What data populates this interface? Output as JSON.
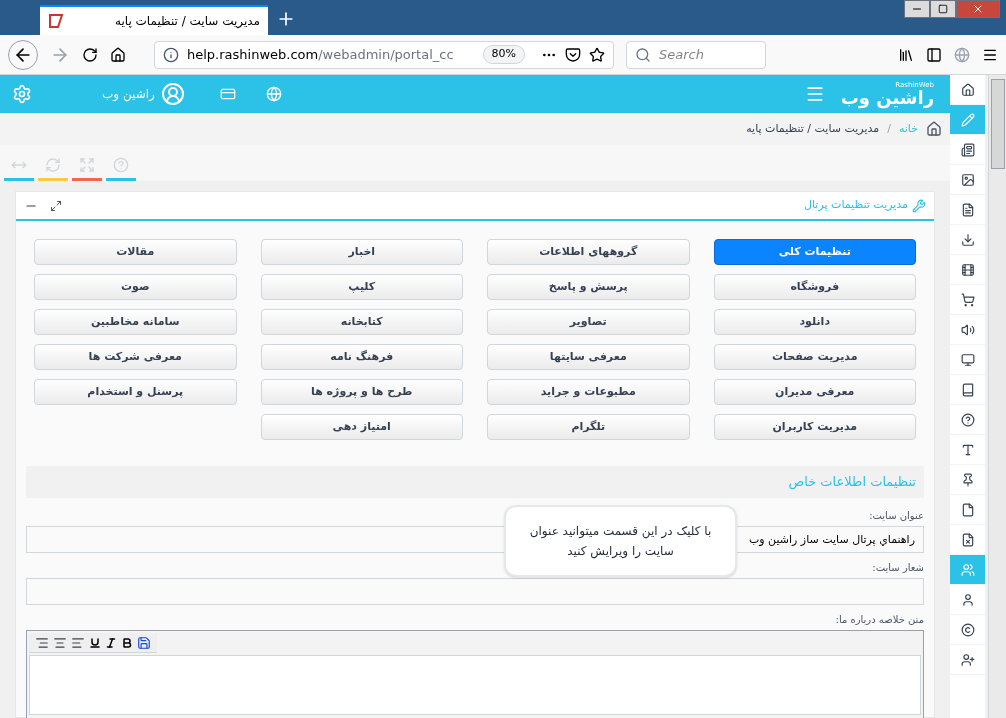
{
  "browser": {
    "tab_title": "مدیریت سایت / تنظیمات پایه",
    "url_host": "help.rashinweb.com",
    "url_path": "/webadmin/portal_cc",
    "zoom": "80%",
    "search": {
      "placeholder": "Search"
    }
  },
  "header": {
    "logo_text": "راشین وب",
    "logo_subtext": "RashinWeb",
    "user_name": "راشین وب"
  },
  "breadcrumb": [
    {
      "label": "خانه",
      "kind": "link"
    },
    {
      "label": "/",
      "kind": "separator"
    },
    {
      "label": "مدیریت سایت / تنظیمات پایه",
      "kind": "current"
    }
  ],
  "tools": [
    {
      "kind": "arrows",
      "color": "#2cc1e6"
    },
    {
      "kind": "refresh",
      "color": "#f9c846"
    },
    {
      "kind": "expand",
      "color": "#f3664c"
    },
    {
      "kind": "help",
      "color": "#2cc1e6"
    }
  ],
  "panel": {
    "title": "مدیریت تنظیمات پرتال",
    "modules": [
      {
        "label": "تنظیمات کلی",
        "selected": true
      },
      {
        "label": "گروههای اطلاعات",
        "selected": false
      },
      {
        "label": "اخبار",
        "selected": false
      },
      {
        "label": "مقالات",
        "selected": false
      },
      {
        "label": "فروشگاه",
        "selected": false
      },
      {
        "label": "پرسش و پاسخ",
        "selected": false
      },
      {
        "label": "کلیپ",
        "selected": false
      },
      {
        "label": "صوت",
        "selected": false
      },
      {
        "label": "دانلود",
        "selected": false
      },
      {
        "label": "تصاویر",
        "selected": false
      },
      {
        "label": "کتابخانه",
        "selected": false
      },
      {
        "label": "سامانه مخاطبین",
        "selected": false
      },
      {
        "label": "مدیریت صفحات",
        "selected": false
      },
      {
        "label": "معرفی سایتها",
        "selected": false
      },
      {
        "label": "فرهنگ نامه",
        "selected": false
      },
      {
        "label": "معرفی شرکت ها",
        "selected": false
      },
      {
        "label": "معرفی مدیران",
        "selected": false
      },
      {
        "label": "مطبوعات و جراید",
        "selected": false
      },
      {
        "label": "طرح ها و پروژه ها",
        "selected": false
      },
      {
        "label": "پرسنل و استخدام",
        "selected": false
      },
      {
        "label": "مدیریت کاربران",
        "selected": false
      },
      {
        "label": "تلگرام",
        "selected": false
      },
      {
        "label": "امتیاز دهی",
        "selected": false
      }
    ],
    "section_title": "تنظیمات اطلاعات خاص",
    "fields": [
      {
        "label": "عنوان سایت:",
        "value": "راهنماي پرتال سایت ساز راشین وب"
      },
      {
        "label": "شعار سایت:"
      }
    ],
    "tooltip": "با کلیک در این قسمت میتوانید عنوان سایت را ویرایش کنید",
    "editor": {
      "label": "متن خلاصه درباره ما:",
      "toolbar": [
        {
          "kind": "align-right"
        },
        {
          "kind": "align-center"
        },
        {
          "kind": "align-left"
        },
        {
          "kind": "underline"
        },
        {
          "kind": "italic"
        },
        {
          "kind": "bold"
        },
        {
          "kind": "save"
        }
      ]
    }
  },
  "sidebar": [
    {
      "kind": "home",
      "selected": false
    },
    {
      "kind": "pencil",
      "selected": true
    },
    {
      "kind": "newspaper",
      "selected": false
    },
    {
      "kind": "image",
      "selected": false
    },
    {
      "kind": "file-text",
      "selected": false
    },
    {
      "kind": "download",
      "selected": false
    },
    {
      "kind": "film",
      "selected": false
    },
    {
      "kind": "cart",
      "selected": false
    },
    {
      "kind": "volume",
      "selected": false
    },
    {
      "kind": "monitor",
      "selected": false
    },
    {
      "kind": "book",
      "selected": false
    },
    {
      "kind": "question",
      "selected": false
    },
    {
      "kind": "text-height",
      "selected": false
    },
    {
      "kind": "pin",
      "selected": false
    },
    {
      "kind": "file",
      "selected": false
    },
    {
      "kind": "file-x",
      "selected": false
    },
    {
      "kind": "users",
      "selected": true
    },
    {
      "kind": "user",
      "selected": false
    },
    {
      "kind": "copyright",
      "selected": false
    },
    {
      "kind": "user-plus",
      "selected": false
    }
  ]
}
